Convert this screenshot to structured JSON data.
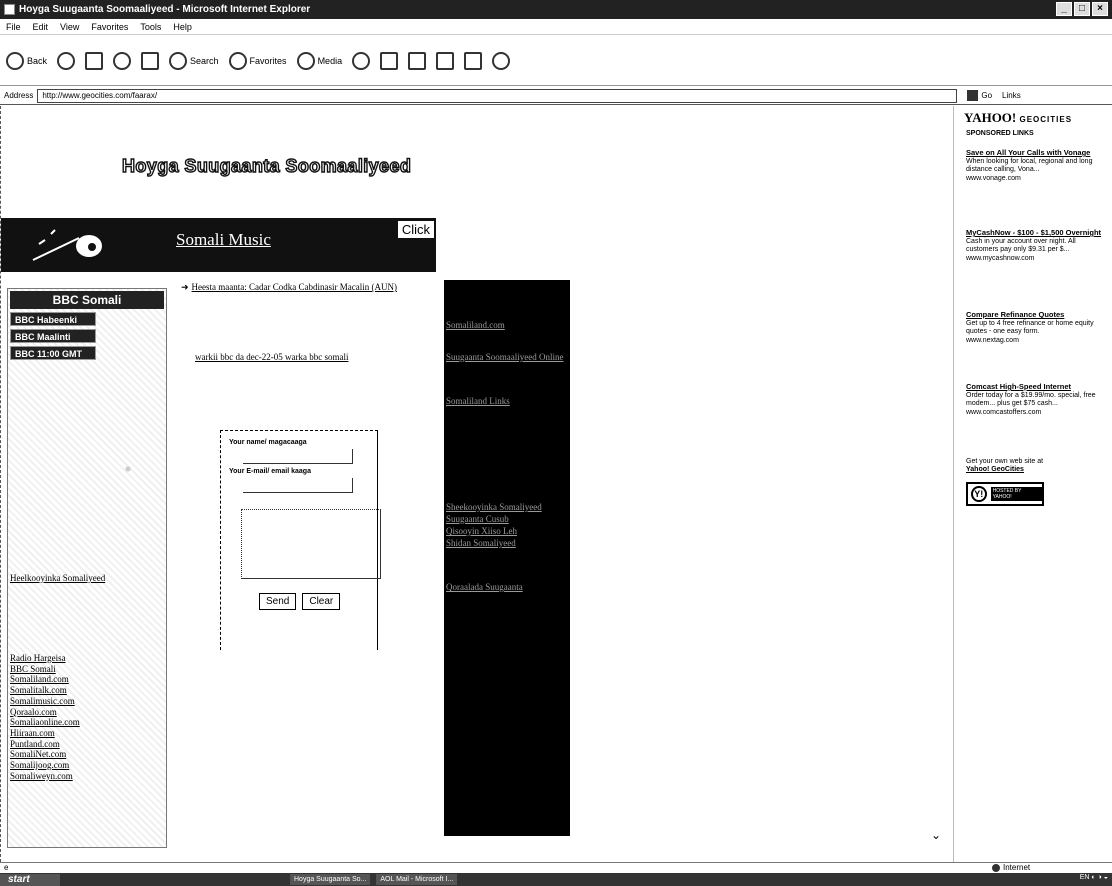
{
  "window": {
    "title": "Hoyga Suugaanta Soomaaliyeed - Microsoft Internet Explorer"
  },
  "menu": [
    "File",
    "Edit",
    "View",
    "Favorites",
    "Tools",
    "Help"
  ],
  "toolbar": {
    "back": "Back",
    "search": "Search",
    "favorites": "Favorites",
    "media": "Media"
  },
  "address": {
    "label": "Address",
    "url": "http://www.geocities.com/faarax/",
    "go": "Go",
    "links": "Links"
  },
  "page": {
    "site_title": "Hoyga Suugaanta Soomaaliyeed",
    "banner": {
      "music_link": "Somali Music",
      "click_label": "Click"
    },
    "bbc": {
      "header": "BBC Somali",
      "buttons": [
        "BBC Habeenki",
        "BBC Maalinti",
        "BBC 11:00 GMT"
      ],
      "single_link": "Heelkooyinka Somaliyeed",
      "links": [
        "Radio Hargeisa",
        "BBC Somali",
        "Somaliland.com",
        "Somalitalk.com",
        "Somalimusic.com",
        "Qoraalo.com",
        "Somaliaonline.com",
        "Hiiraan.com",
        "Puntland.com",
        "SomaliNet.com",
        "Somalijoog.com",
        "Somaliweyn.com"
      ]
    },
    "news": [
      "Heesta maanta: Cadar Codka Cabdinasir Macalin (AUN)",
      "warkii bbc da dec-22-05 warka bbc somali"
    ],
    "form": {
      "name_label": "Your name/ magacaaga",
      "email_label": "Your E-mail/ email kaaga",
      "send": "Send",
      "clear": "Clear"
    },
    "black_links": [
      "Somaliland.com",
      "Suugaanta Soomaaliyeed Online",
      "Somaliland Links",
      "Sheekooyinka Somaliyeed",
      "Suugaanta Cusub",
      "Qisooyin Xiiso Leh",
      "Shidan Somaliyeed",
      "Qoraalada Suugaanta"
    ]
  },
  "yahoo": {
    "logo": "YAHOO!",
    "logo_suffix": "GEOCITIES",
    "sponsored": "SPONSORED LINKS",
    "ads": [
      {
        "title": "Save on All Your Calls with Vonage",
        "text": "When looking for local, regional and long distance calling, Vona...",
        "url": "www.vonage.com"
      },
      {
        "title": "MyCashNow - $100 - $1,500 Overnight",
        "text": "Cash in your account over night. All customers pay only $9.31 per $...",
        "url": "www.mycashnow.com"
      },
      {
        "title": "Compare Refinance Quotes",
        "text": "Get up to 4 free refinance or home equity quotes - one easy form.",
        "url": "www.nextag.com"
      },
      {
        "title": "Comcast High-Speed Internet",
        "text": "Order today for a $19.99/mo. special, free modem... plus get $75 cash...",
        "url": "www.comcastoffers.com"
      }
    ],
    "own_site_text": "Get your own web site at",
    "own_site_link": "Yahoo! GeoCities",
    "hosted_badge": "HOSTED BY YAHOO!"
  },
  "status": {
    "zone": "Internet"
  },
  "taskbar": {
    "start": "start",
    "tasks": [
      "Hoyga Suugaanta So...",
      "AOL Mail - Microsoft I..."
    ]
  }
}
